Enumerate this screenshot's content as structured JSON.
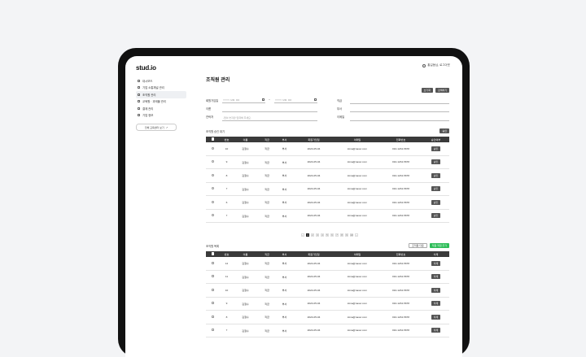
{
  "app": {
    "logo": "stud.io",
    "user_text": "홍길동님, 로그아웃"
  },
  "sidebar": {
    "items": [
      {
        "label": "대시보드",
        "icon": "home-icon"
      },
      {
        "label": "기업 소통채널 관리",
        "icon": "chat-icon"
      },
      {
        "label": "조직원 관리",
        "icon": "user-icon",
        "active": true
      },
      {
        "label": "교육원 · 과제물 관리",
        "icon": "book-icon"
      },
      {
        "label": "결제 관리",
        "icon": "card-icon"
      },
      {
        "label": "기업 정보",
        "icon": "building-icon"
      }
    ],
    "link_button": "전체 교육센터 보기"
  },
  "page": {
    "title": "조직원 관리"
  },
  "toolbar": {
    "reset": "초기화",
    "search": "검색하기"
  },
  "filters": {
    "date_label": "회원가입일",
    "date_from": "YYYY. MM. DD",
    "date_sep": "~",
    "date_to": "YYYY. MM. DD",
    "name_label": "이름",
    "phone_label": "연락처",
    "phone_placeholder": "-없이 숫자만 입력해 주세요.",
    "rank_label": "직급",
    "dept_label": "부서",
    "email_label": "이메일"
  },
  "section1": {
    "label": "조직원 승인 대기",
    "action": "승인"
  },
  "table1": {
    "headers": [
      "",
      "번호",
      "이름",
      "직급",
      "부서",
      "회원가입일",
      "이메일",
      "전화번호",
      "승인여부"
    ],
    "rows": [
      [
        "10",
        "김철수",
        "직급",
        "부서",
        "2024-05-04",
        "kima@naver.com",
        "010-1234-5678",
        "승인"
      ],
      [
        "9",
        "김철수",
        "직급",
        "부서",
        "2024-05-04",
        "kima@naver.com",
        "010-1234-5678",
        "승인"
      ],
      [
        "8",
        "김철수",
        "직급",
        "부서",
        "2024-05-04",
        "kima@naver.com",
        "010-1234-5678",
        "승인"
      ],
      [
        "7",
        "김철수",
        "직급",
        "부서",
        "2024-05-04",
        "kima@naver.com",
        "010-1234-5678",
        "승인"
      ],
      [
        "6",
        "김철수",
        "직급",
        "부서",
        "2024-05-04",
        "kima@naver.com",
        "010-1234-5678",
        "승인"
      ],
      [
        "7",
        "김철수",
        "직급",
        "부서",
        "2024-05-04",
        "kima@naver.com",
        "010-1234-5678",
        "승인"
      ]
    ]
  },
  "pagination": {
    "prev": "‹",
    "pages": [
      "1",
      "2",
      "3",
      "4",
      "5",
      "6",
      "7",
      "8",
      "9",
      "10"
    ],
    "current": "1",
    "next": "›"
  },
  "section2": {
    "label": "조직원 목록",
    "excel": "조직원 다운",
    "add": "직원 직접 추가"
  },
  "table2": {
    "headers": [
      "",
      "번호",
      "이름",
      "직급",
      "부서",
      "회원가입일",
      "이메일",
      "전화번호",
      "삭제"
    ],
    "rows": [
      [
        "12",
        "김철수",
        "직급",
        "부서",
        "2024-05-04",
        "kima@naver.com",
        "010-1234-5678",
        "삭제"
      ],
      [
        "11",
        "김철수",
        "직급",
        "부서",
        "2024-05-04",
        "kima@naver.com",
        "010-1234-5678",
        "삭제"
      ],
      [
        "10",
        "김철수",
        "직급",
        "부서",
        "2024-05-04",
        "kima@naver.com",
        "010-1234-5678",
        "삭제"
      ],
      [
        "9",
        "김철수",
        "직급",
        "부서",
        "2024-05-04",
        "kima@naver.com",
        "010-1234-5678",
        "삭제"
      ],
      [
        "8",
        "김철수",
        "직급",
        "부서",
        "2024-05-04",
        "kima@naver.com",
        "010-1234-5678",
        "삭제"
      ],
      [
        "7",
        "김철수",
        "직급",
        "부서",
        "2024-05-04",
        "kima@naver.com",
        "010-1234-5678",
        "삭제"
      ]
    ]
  }
}
